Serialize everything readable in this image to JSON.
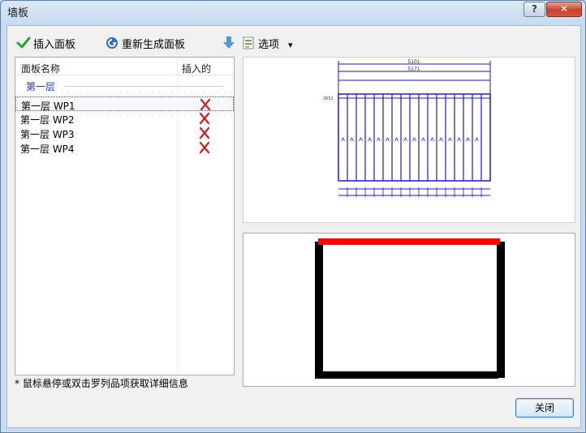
{
  "window": {
    "title": "墙板",
    "help_label": "?",
    "close_label": "✕"
  },
  "toolbar": {
    "insert_label": "插入面板",
    "regen_label": "重新生成面板",
    "options_label": "选项",
    "dropdown_glyph": "▾"
  },
  "list": {
    "col_name": "面板名称",
    "col_inserted": "插入的",
    "group": "第一层",
    "rows": [
      {
        "name": "第一层 WP1",
        "inserted": false
      },
      {
        "name": "第一层 WP2",
        "inserted": false
      },
      {
        "name": "第一层 WP3",
        "inserted": false
      },
      {
        "name": "第一层 WP4",
        "inserted": false
      }
    ]
  },
  "preview": {
    "dim_total": "5101",
    "dim_inner": "5171",
    "left_height": "2652"
  },
  "hint": "* 鼠标悬停或双击罗列品项获取详细信息",
  "footer": {
    "close_button": "关闭"
  },
  "colors": {
    "accent_red": "#ff0000",
    "stud_blue": "#1a1acc",
    "link_blue": "#1e3f8f"
  }
}
